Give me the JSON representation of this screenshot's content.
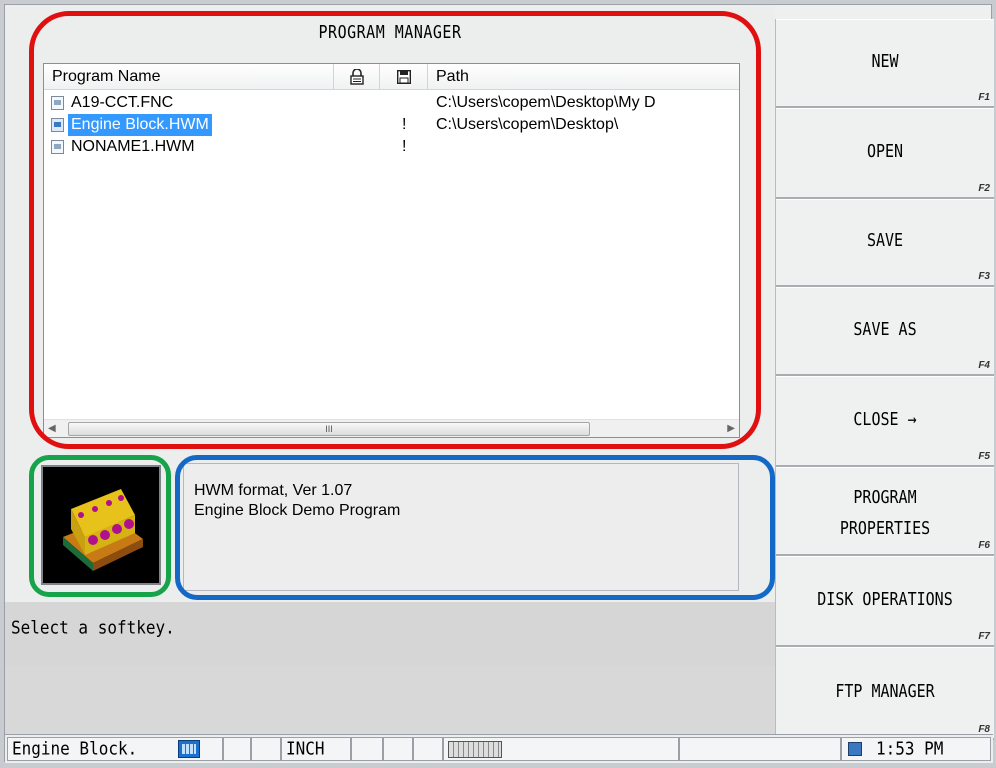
{
  "window": {
    "title": "PROGRAM MANAGER"
  },
  "program_list": {
    "columns": {
      "name": "Program Name",
      "lock_icon": "lock-icon",
      "save_icon": "floppy-disk-icon",
      "path": "Path"
    },
    "rows": [
      {
        "name": "A19-CCT.FNC",
        "modified": "",
        "path": "C:\\Users\\copem\\Desktop\\My D",
        "selected": false
      },
      {
        "name": "Engine Block.HWM",
        "modified": "!",
        "path": "C:\\Users\\copem\\Desktop\\",
        "selected": true
      },
      {
        "name": "NONAME1.HWM",
        "modified": "!",
        "path": "",
        "selected": false
      }
    ],
    "scroll_grip": "III"
  },
  "preview": {
    "icon": "engine-block-3d-thumbnail"
  },
  "description": {
    "line1": "HWM format, Ver 1.07",
    "line2": "Engine Block Demo Program"
  },
  "message": {
    "text": "Select a softkey."
  },
  "softkeys": [
    {
      "label": "NEW",
      "label2": "",
      "key": "F1"
    },
    {
      "label": "OPEN",
      "label2": "",
      "key": "F2"
    },
    {
      "label": "SAVE",
      "label2": "",
      "key": "F3"
    },
    {
      "label": "SAVE AS",
      "label2": "",
      "key": "F4"
    },
    {
      "label": "CLOSE →",
      "label2": "",
      "key": "F5"
    },
    {
      "label": "PROGRAM",
      "label2": "PROPERTIES",
      "key": "F6"
    },
    {
      "label": "DISK OPERATIONS",
      "label2": "",
      "key": "F7"
    },
    {
      "label": "FTP MANAGER",
      "label2": "",
      "key": "F8"
    }
  ],
  "status_bar": {
    "program": "Engine Block.",
    "units": "INCH",
    "time": "1:53 PM"
  },
  "annotation_colors": {
    "red": "#e01010",
    "green": "#16a34a",
    "blue": "#1468c6"
  }
}
